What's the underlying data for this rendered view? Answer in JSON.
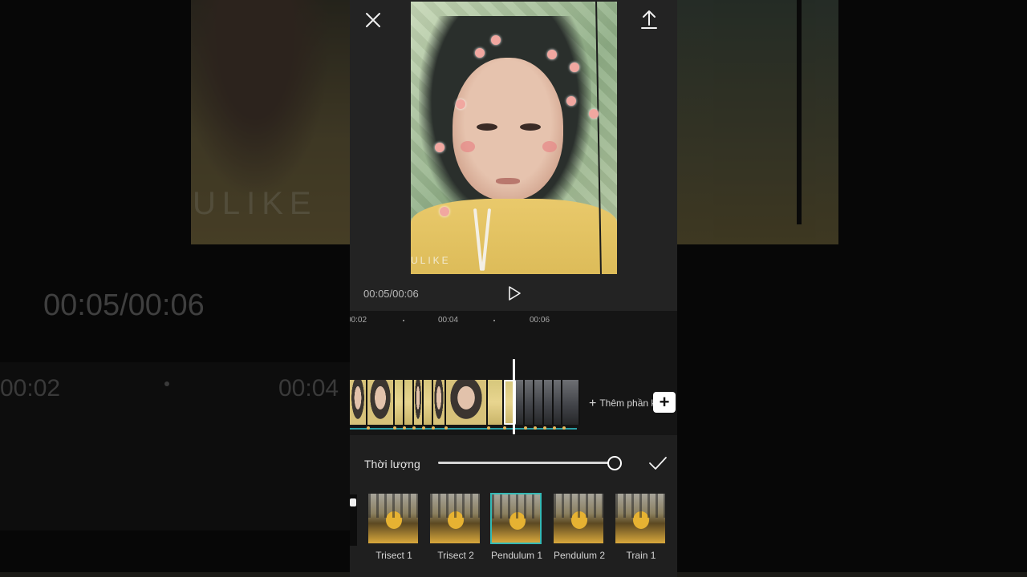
{
  "player": {
    "timecode": "00:05/00:06",
    "background_timecode": "00:05/00:06",
    "watermark": "ULIKE",
    "background_watermark": "ULIKE"
  },
  "icons": {
    "close": "close-icon",
    "fullscreen": "fullscreen-icon",
    "upload": "upload-icon",
    "play": "play-icon",
    "confirm": "checkmark-icon",
    "add": "plus-icon"
  },
  "timeline": {
    "ruler_labels": [
      "00:02",
      "00:04",
      "00:06"
    ],
    "background_ruler_labels": [
      "00:02",
      "00:04"
    ],
    "add_part_label": "Thêm phần k",
    "add_button_symbol": "+"
  },
  "duration": {
    "label": "Thời lượng",
    "value": 0.98
  },
  "transitions": {
    "selected": "Pendulum 1",
    "items": [
      {
        "label": "Trisect 1"
      },
      {
        "label": "Trisect 2"
      },
      {
        "label": "Pendulum 1"
      },
      {
        "label": "Pendulum 2"
      },
      {
        "label": "Train 1"
      }
    ]
  },
  "colors": {
    "accent": "#34b9b5",
    "panel": "#1f1f1f",
    "timeline_bg": "#151515",
    "keyframe": "#e6b85a"
  }
}
